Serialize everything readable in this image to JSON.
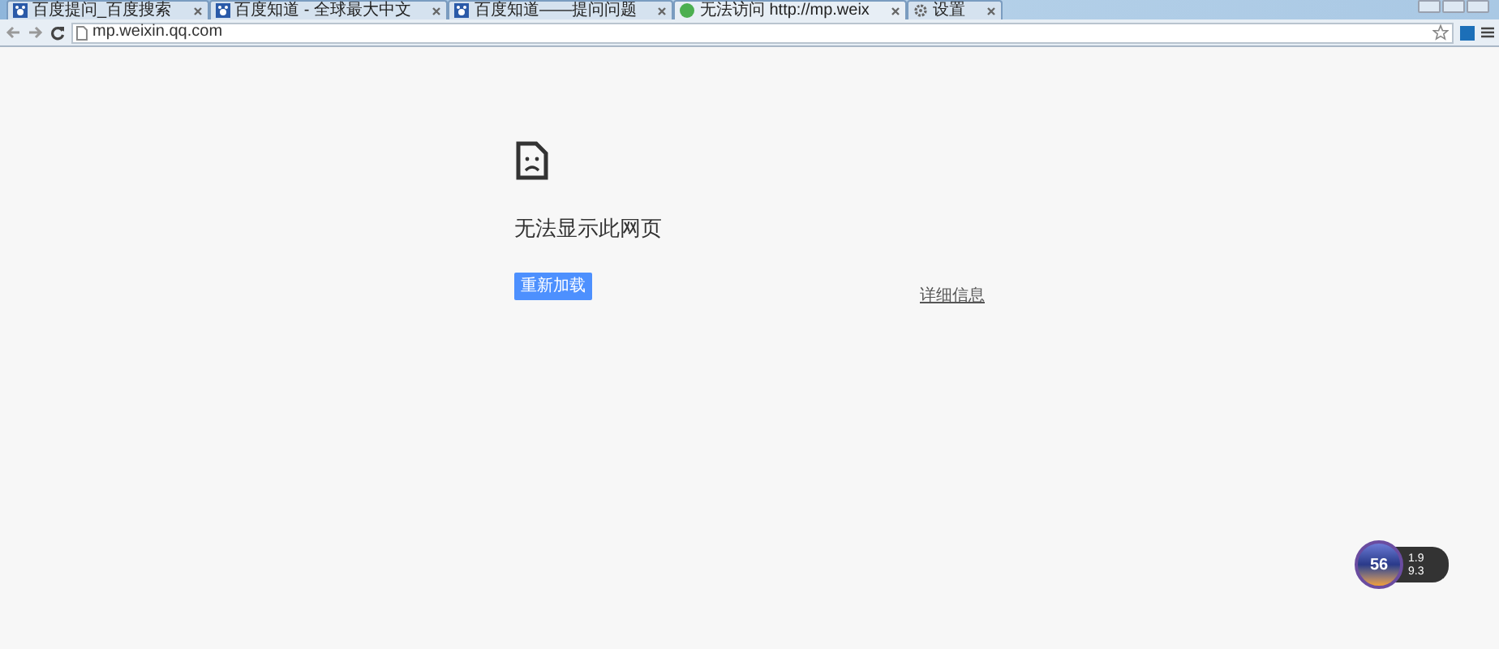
{
  "tabs": [
    {
      "title": "百度提问_百度搜索",
      "kind": "paw",
      "selected": false
    },
    {
      "title": "百度知道 - 全球最大中文",
      "kind": "paw",
      "selected": false
    },
    {
      "title": "百度知道——提问问题",
      "kind": "paw",
      "selected": false
    },
    {
      "title": "无法访问 http://mp.weix",
      "kind": "globe",
      "selected": true
    },
    {
      "title": "设置",
      "kind": "gear",
      "selected": false
    }
  ],
  "address": "mp.weixin.qq.com",
  "error": {
    "title": "无法显示此网页",
    "reload_button": "重新加载",
    "details_link": "详细信息"
  },
  "speed_widget": {
    "score": "56",
    "upload": "1.9",
    "download": "9.3"
  }
}
